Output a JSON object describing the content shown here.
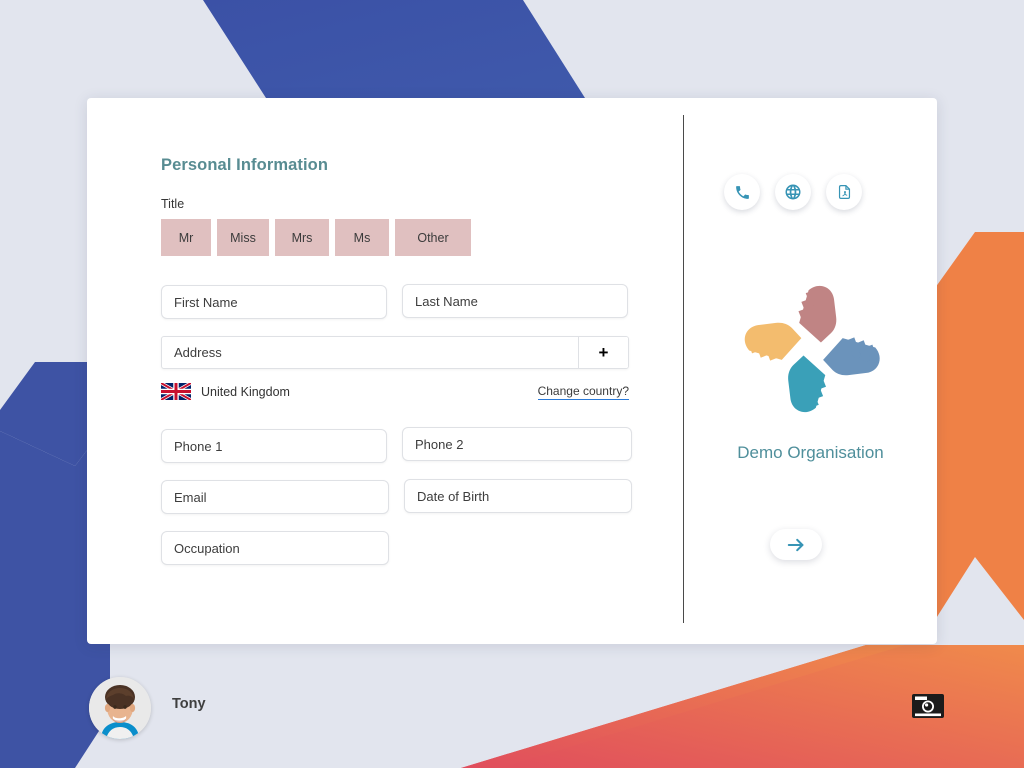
{
  "theme": {
    "page_background": "#e2e5ee",
    "card_background": "#ffffff",
    "accent_teal": "#588c92",
    "title_button_bg": "#e0c0c0",
    "shape_blue": "#3e53a4",
    "shape_orange": "#ef8146",
    "shape_red": "#e1504f",
    "link_underline": "#2979d8"
  },
  "form": {
    "section_title": "Personal Information",
    "title_label": "Title",
    "title_options": [
      "Mr",
      "Miss",
      "Mrs",
      "Ms",
      "Other"
    ],
    "fields": {
      "first_name": {
        "placeholder": "First Name",
        "value": ""
      },
      "last_name": {
        "placeholder": "Last Name",
        "value": ""
      },
      "address": {
        "placeholder": "Address",
        "value": ""
      },
      "phone1": {
        "placeholder": "Phone 1",
        "value": ""
      },
      "phone2": {
        "placeholder": "Phone 2",
        "value": ""
      },
      "email": {
        "placeholder": "Email",
        "value": ""
      },
      "date_of_birth": {
        "placeholder": "Date of Birth",
        "value": ""
      },
      "occupation": {
        "placeholder": "Occupation",
        "value": ""
      }
    },
    "address_add_label": "+",
    "country": {
      "name": "United Kingdom",
      "flag_icon": "uk-flag-icon",
      "change_link": "Change country?"
    }
  },
  "right_panel": {
    "quick_actions": [
      {
        "icon": "phone-icon",
        "name": "phone-action"
      },
      {
        "icon": "globe-icon",
        "name": "website-action"
      },
      {
        "icon": "pdf-file-icon",
        "name": "pdf-action"
      }
    ],
    "organisation_name": "Demo Organisation",
    "logo_icon": "four-hands-logo",
    "next_icon": "arrow-right-icon"
  },
  "footer": {
    "user_name": "Tony",
    "avatar_icon": "user-avatar",
    "camera_icon": "camera-icon"
  }
}
